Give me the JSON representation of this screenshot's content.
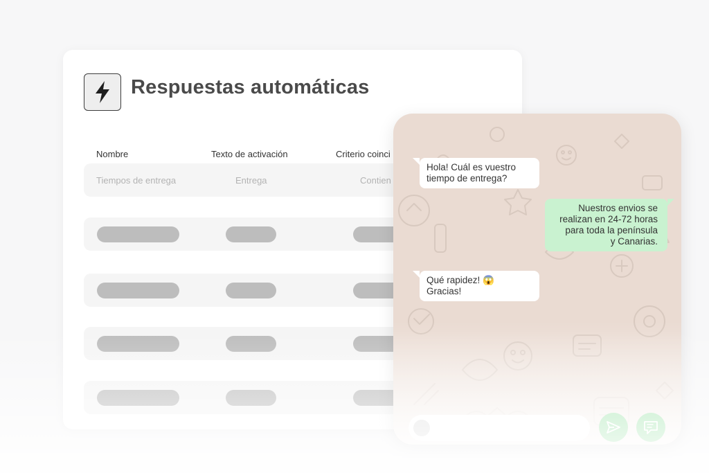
{
  "panel": {
    "title": "Respuestas automáticas",
    "icon": "lightning-bolt-icon",
    "columns": [
      "Nombre",
      "Texto de activación",
      "Criterio coinci"
    ],
    "first_row": [
      "Tiempos de entrega",
      "Entrega",
      "Contien"
    ]
  },
  "chat": {
    "messages": [
      {
        "direction": "incoming",
        "line1": "Hola! Cuál es vuestro",
        "line2": "tiempo de entrega?"
      },
      {
        "direction": "outgoing",
        "lines": [
          "Nuestros envios se",
          "realizan en 24-72 horas",
          "para toda la península",
          "y Canarias."
        ]
      },
      {
        "direction": "incoming",
        "line1": "Qué rapidez! 😱",
        "line2": "Gracias!"
      }
    ],
    "send_icon": "send-icon",
    "quick_reply_icon": "quick-reply-icon"
  },
  "colors": {
    "chat_background": "#eadbd2",
    "outgoing_bubble": "#c9f2d0",
    "accent_green": "#a9e6b4",
    "skeleton": "#bdbdbd"
  }
}
